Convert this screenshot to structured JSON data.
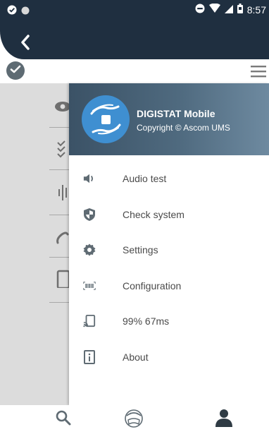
{
  "status_bar": {
    "time": "8:57",
    "icons": [
      "check-circle-icon",
      "dot-icon",
      "do-not-disturb-icon",
      "wifi-icon",
      "cell-signal-icon",
      "battery-icon"
    ]
  },
  "header": {
    "back_icon": "chevron-left-icon",
    "status_icon": "check-circle-icon",
    "menu_icon": "hamburger-menu-icon"
  },
  "drawer": {
    "app_name": "DIGISTAT Mobile",
    "copyright": "Copyright © Ascom UMS",
    "logo_icon": "hands-logo-icon",
    "items": [
      {
        "label": "Audio test",
        "icon": "speaker-icon"
      },
      {
        "label": "Check system",
        "icon": "shield-icon"
      },
      {
        "label": "Settings",
        "icon": "gear-icon"
      },
      {
        "label": "Configuration",
        "icon": "barcode-icon"
      },
      {
        "label": "99% 67ms",
        "icon": "cast-icon"
      },
      {
        "label": "About",
        "icon": "info-icon"
      }
    ]
  },
  "tab_bar": {
    "items": [
      {
        "icon": "search-icon"
      },
      {
        "icon": "patient-face-icon"
      },
      {
        "icon": "user-icon"
      }
    ]
  },
  "colors": {
    "header_dark": "#1f2f40",
    "drawer_head": "#4f6a7f",
    "logo_blue": "#3f8fd1",
    "icon_grey": "#5f6b73",
    "overlay": "#dcdcdc"
  }
}
